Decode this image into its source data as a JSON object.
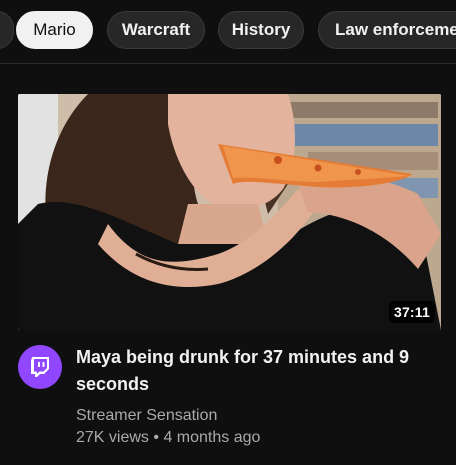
{
  "chips": [
    {
      "label": "Mario",
      "selected": true
    },
    {
      "label": "Warcraft",
      "selected": false
    },
    {
      "label": "History",
      "selected": false
    },
    {
      "label": "Law enforcement",
      "selected": false
    }
  ],
  "video": {
    "duration": "37:11",
    "title": "Maya being drunk for 37 minutes and 9 seconds",
    "channel": "Streamer Sensation",
    "views": "27K views",
    "separator": "•",
    "age": "4 months ago",
    "avatar_icon": "twitch-logo-icon"
  },
  "colors": {
    "background": "#0f0f0f",
    "chip_bg": "#272727",
    "chip_selected_bg": "#f1f1f1",
    "avatar_bg": "#9146ff",
    "secondary_text": "#aaaaaa"
  }
}
